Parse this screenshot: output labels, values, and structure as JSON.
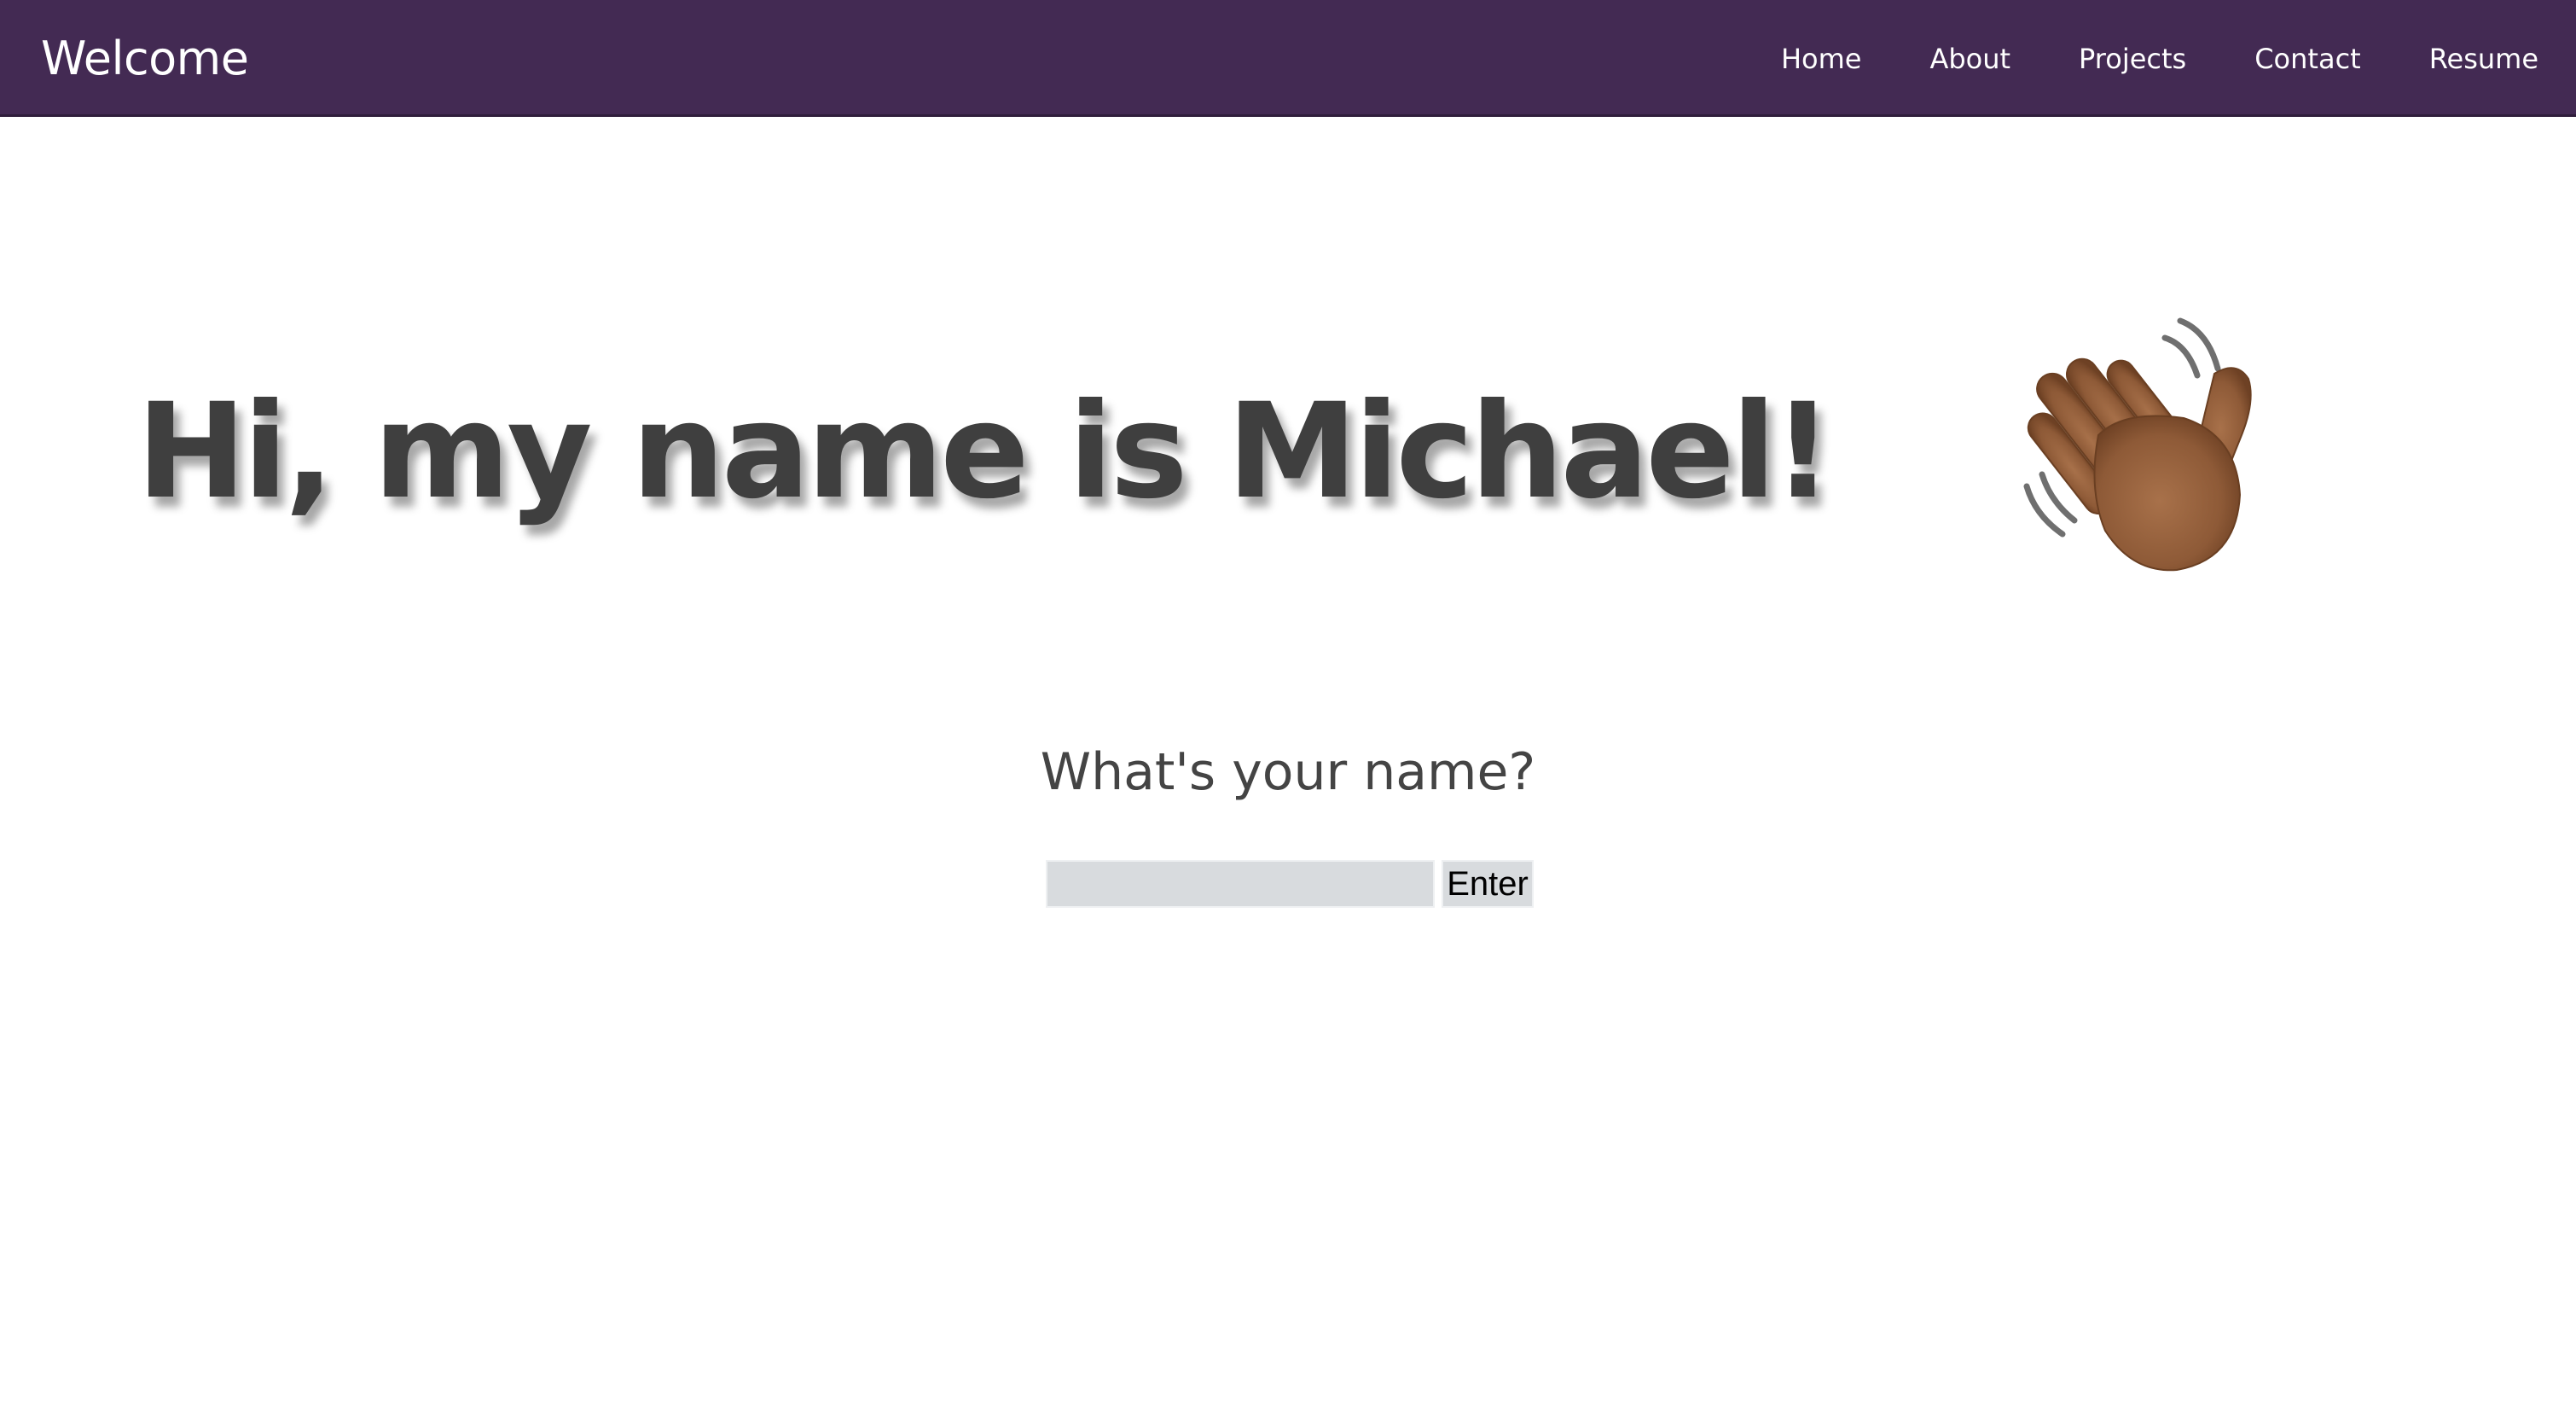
{
  "header": {
    "brand": "Welcome",
    "background_color": "#432a53",
    "nav": [
      {
        "label": "Home"
      },
      {
        "label": "About"
      },
      {
        "label": "Projects"
      },
      {
        "label": "Contact"
      },
      {
        "label": "Resume"
      }
    ]
  },
  "hero": {
    "title": "Hi, my name is Michael!",
    "icon": "waving-hand-icon"
  },
  "name_form": {
    "prompt": "What's your name?",
    "input_value": "",
    "input_placeholder": "",
    "submit_label": "Enter"
  }
}
